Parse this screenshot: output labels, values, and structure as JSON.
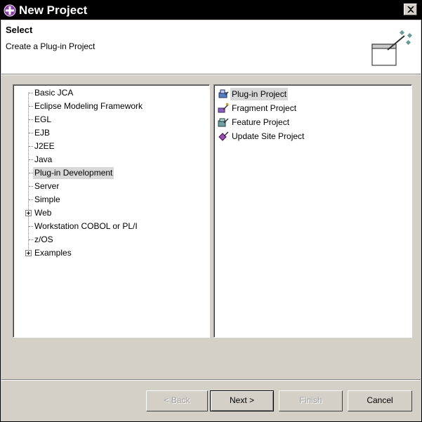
{
  "window": {
    "title": "New Project",
    "app_icon": "eclipse-plugin-icon",
    "close_icon": "close-icon"
  },
  "header": {
    "title": "Select",
    "description": "Create a Plug-in Project",
    "icon": "new-wizard-icon"
  },
  "categories": [
    {
      "label": "Basic JCA",
      "expandable": false
    },
    {
      "label": "Eclipse Modeling Framework",
      "expandable": false
    },
    {
      "label": "EGL",
      "expandable": false
    },
    {
      "label": "EJB",
      "expandable": false
    },
    {
      "label": "J2EE",
      "expandable": false
    },
    {
      "label": "Java",
      "expandable": false
    },
    {
      "label": "Plug-in Development",
      "expandable": false,
      "selected": true
    },
    {
      "label": "Server",
      "expandable": false
    },
    {
      "label": "Simple",
      "expandable": false
    },
    {
      "label": "Web",
      "expandable": true
    },
    {
      "label": "Workstation COBOL or PL/I",
      "expandable": false
    },
    {
      "label": "z/OS",
      "expandable": false
    },
    {
      "label": "Examples",
      "expandable": true
    }
  ],
  "project_types": [
    {
      "label": "Plug-in Project",
      "icon": "plugin-project-icon",
      "selected": true
    },
    {
      "label": "Fragment Project",
      "icon": "fragment-project-icon"
    },
    {
      "label": "Feature Project",
      "icon": "feature-project-icon"
    },
    {
      "label": "Update Site Project",
      "icon": "update-site-project-icon"
    }
  ],
  "buttons": {
    "back": "< Back",
    "next": "Next >",
    "finish": "Finish",
    "cancel": "Cancel"
  }
}
